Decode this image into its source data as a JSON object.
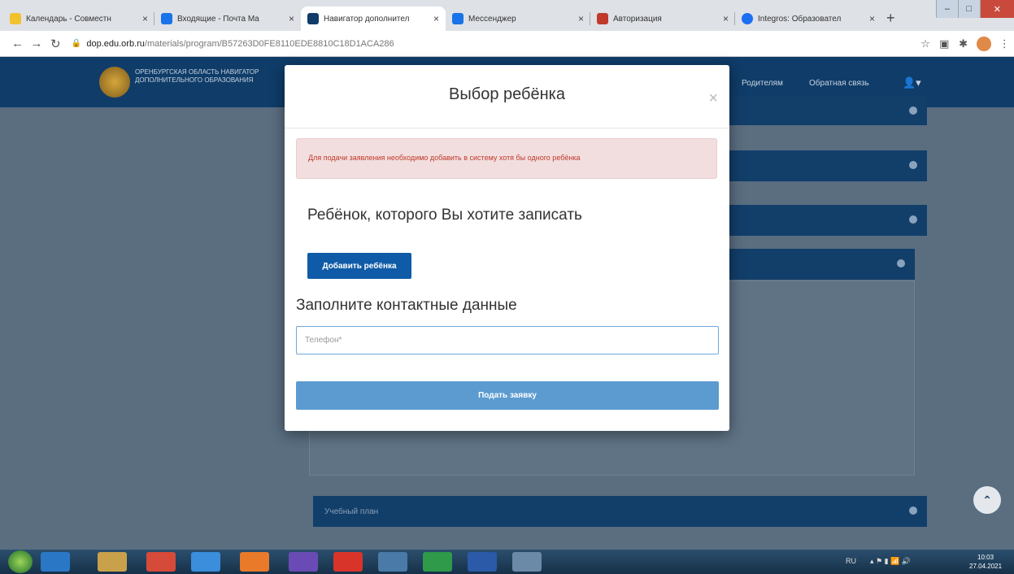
{
  "browser": {
    "tabs": [
      {
        "title": "Календарь - Совместн",
        "color": "#f2c12e"
      },
      {
        "title": "Входящие - Почта Ma",
        "color": "#1a73e8"
      },
      {
        "title": "Навигатор дополнител",
        "color": "#0f3c69"
      },
      {
        "title": "Мессенджер",
        "color": "#1a73e8"
      },
      {
        "title": "Авторизация",
        "color": "#c0392b"
      },
      {
        "title": "Integros: Образовател",
        "color": "#1d6ff2"
      }
    ],
    "url_host": "dop.edu.orb.ru",
    "url_path": "/materials/program/B57263D0FE8110EDE8810C18D1ACA286"
  },
  "site": {
    "logo_text": "Оренбургская область навигатор дополнительного образования",
    "nav": [
      "Родителям",
      "Обратная связь"
    ],
    "bottom_panel_label": "Учебный план"
  },
  "modal": {
    "title": "Выбор ребёнка",
    "close": "×",
    "alert": "Для подачи заявления необходимо добавить в систему хотя бы одного ребёнка",
    "child_heading": "Ребёнок, которого Вы хотите записать",
    "add_child_button": "Добавить ребёнка",
    "contacts_heading": "Заполните контактные данные",
    "phone_placeholder": "Телефон*",
    "submit_button": "Подать заявку"
  },
  "taskbar": {
    "lang": "RU",
    "time": "10:03",
    "date": "27.04.2021"
  }
}
